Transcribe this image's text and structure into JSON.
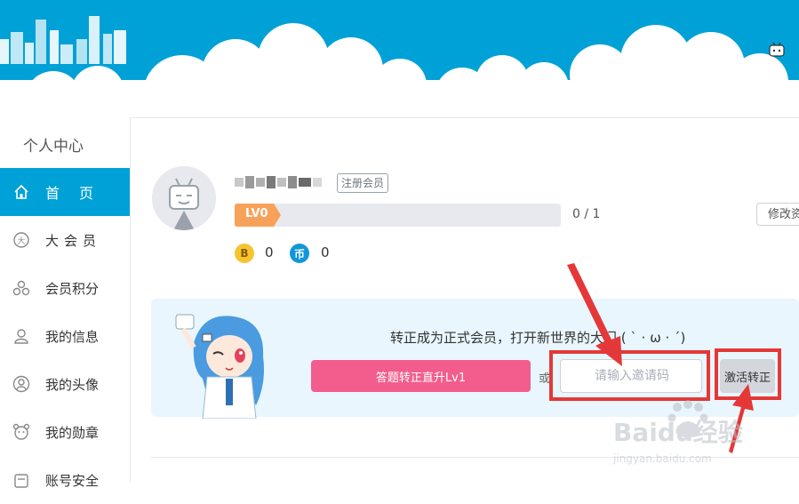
{
  "sidebar": {
    "title": "个人中心",
    "items": [
      {
        "label": "首页",
        "icon": "home-icon",
        "active": true
      },
      {
        "label": "大会员",
        "icon": "vip-icon",
        "active": false
      },
      {
        "label": "会员积分",
        "icon": "points-icon",
        "active": false
      },
      {
        "label": "我的信息",
        "icon": "user-icon",
        "active": false
      },
      {
        "label": "我的头像",
        "icon": "avatar-icon",
        "active": false
      },
      {
        "label": "我的勋章",
        "icon": "medal-icon",
        "active": false
      },
      {
        "label": "账号安全",
        "icon": "security-icon",
        "active": false
      }
    ]
  },
  "profile": {
    "register_badge": "注册会员",
    "level": "LV0",
    "exp": "0 / 1",
    "edit_label": "修改资",
    "b_coin_icon": "B",
    "b_coins": "0",
    "coin_icon": "币",
    "coins": "0"
  },
  "promo": {
    "text": "转正成为正式会员，打开新世界的大门 ( ` · ω · ´)",
    "quiz_button": "答题转正直升Lv1",
    "or": "或",
    "code_placeholder": "请输入邀请码",
    "activate_button": "激活转正"
  },
  "watermark": {
    "brand": "Baidu经验",
    "url": "jingyan.baidu.com"
  },
  "colors": {
    "brand_blue": "#00a1d6",
    "pink": "#f25d8e",
    "level_orange": "#f7a25a",
    "highlight_red": "#e43838"
  }
}
